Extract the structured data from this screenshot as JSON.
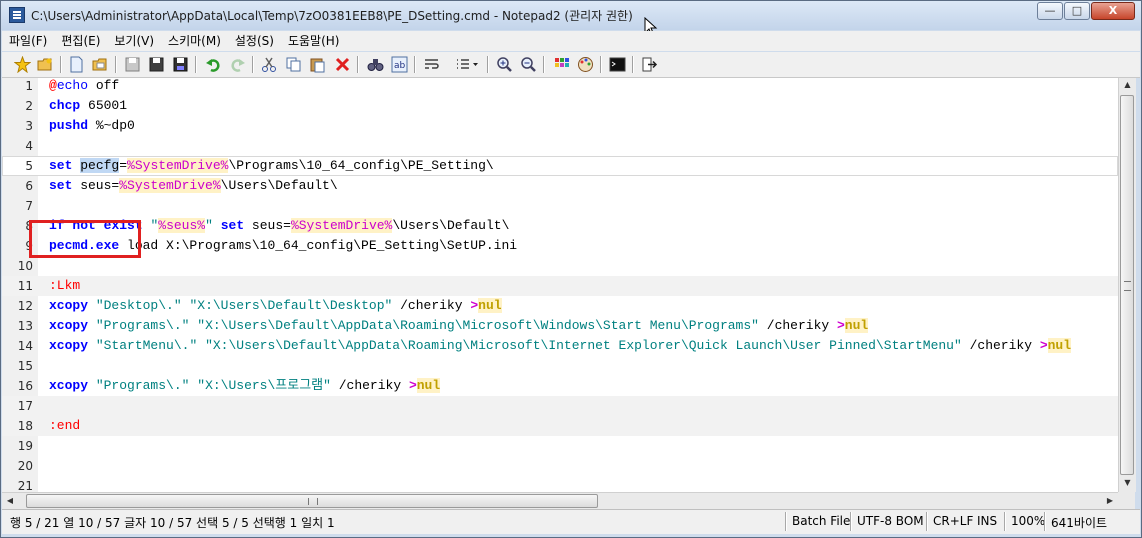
{
  "window": {
    "title": "C:\\Users\\Administrator\\AppData\\Local\\Temp\\7zO0381EEB8\\PE_DSetting.cmd - Notepad2 (관리자 권한)",
    "buttons": {
      "minimize": "—",
      "maximize": "□",
      "close": "X"
    }
  },
  "menu": [
    "파일(F)",
    "편집(E)",
    "보기(V)",
    "스키마(M)",
    "설정(S)",
    "도움말(H)"
  ],
  "toolbar": {
    "icons": [
      "new-file-icon",
      "open-folder-icon",
      "new-doc-icon",
      "open-doc-icon",
      "save-disk-icon",
      "save-icon",
      "save-as-icon",
      "undo-icon",
      "redo-icon",
      "cut-icon",
      "copy-icon",
      "paste-icon",
      "delete-icon",
      "find-icon",
      "replace-icon",
      "wrap-icon",
      "list-icon",
      "zoom-in-icon",
      "zoom-out-icon",
      "scheme-icon",
      "color-icon",
      "console-icon",
      "exit-icon"
    ]
  },
  "editor": {
    "current_line": 5,
    "lines": [
      {
        "n": "1",
        "text": "@echo off"
      },
      {
        "n": "2",
        "text": "chcp 65001"
      },
      {
        "n": "3",
        "text": "pushd %~dp0"
      },
      {
        "n": "4",
        "text": ""
      },
      {
        "n": "5",
        "text": "set pecfg=%SystemDrive%\\Programs\\10_64_config\\PE_Setting\\"
      },
      {
        "n": "6",
        "text": "set seus=%SystemDrive%\\Users\\Default\\"
      },
      {
        "n": "7",
        "text": ""
      },
      {
        "n": "8",
        "text": "if not exist \"%seus%\" set seus=%SystemDrive%\\Users\\Default\\"
      },
      {
        "n": "9",
        "text": "pecmd.exe load X:\\Programs\\10_64_config\\PE_Setting\\SetUP.ini"
      },
      {
        "n": "10",
        "text": ""
      },
      {
        "n": "11",
        "text": ":Lkm"
      },
      {
        "n": "12",
        "text": "xcopy \"Desktop\\.\" \"X:\\Users\\Default\\Desktop\" /cheriky >nul"
      },
      {
        "n": "13",
        "text": "xcopy \"Programs\\.\" \"X:\\Users\\Default\\AppData\\Roaming\\Microsoft\\Windows\\Start Menu\\Programs\" /cheriky >nul"
      },
      {
        "n": "14",
        "text": "xcopy \"StartMenu\\.\" \"X:\\Users\\Default\\AppData\\Roaming\\Microsoft\\Internet Explorer\\Quick Launch\\User Pinned\\StartMenu\" /cheriky >nul"
      },
      {
        "n": "15",
        "text": ""
      },
      {
        "n": "16",
        "text": "xcopy \"Programs\\.\" \"X:\\Users\\프로그램\" /cheriky >nul"
      },
      {
        "n": "17",
        "text": ""
      },
      {
        "n": "18",
        "text": ":end"
      },
      {
        "n": "19",
        "text": ""
      },
      {
        "n": "20",
        "text": ""
      },
      {
        "n": "21",
        "text": ""
      }
    ],
    "highlight_color": "#e02020"
  },
  "statusbar": {
    "position": "행 5 / 21  열 10 / 57  글자 10 / 57  선택 5 / 5  선택행 1  일치 1",
    "filetype": "Batch File",
    "encoding": "UTF-8 BOM",
    "eol": "CR+LF",
    "mode": "INS",
    "zoom": "100%",
    "size": "641바이트"
  }
}
